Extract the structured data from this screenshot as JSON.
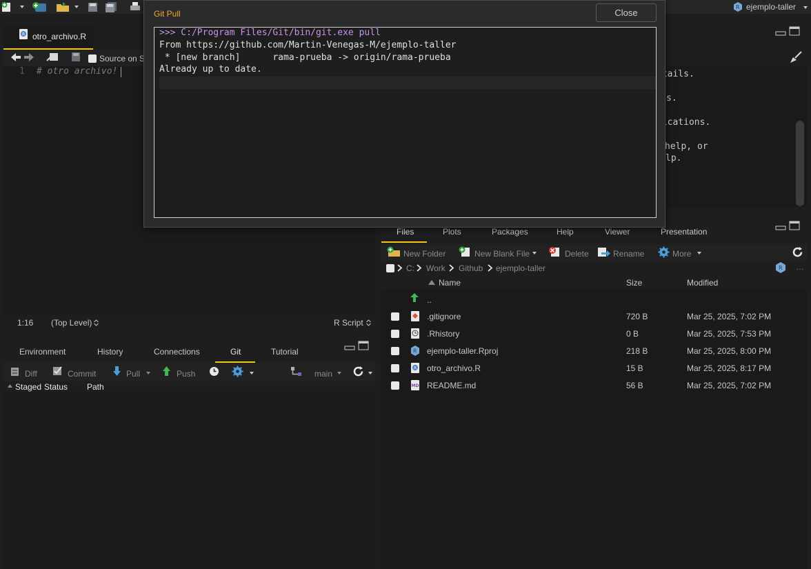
{
  "project": {
    "name": "ejemplo-taller"
  },
  "editor": {
    "tab_label": "otro_archivo.R",
    "source_on_save": "Source on S",
    "line_number": "1",
    "line_code": "# otro archivo!",
    "status_position": "1:16",
    "status_scope": "(Top Level)",
    "status_type": "R Script"
  },
  "bottom_left": {
    "tabs": [
      "Environment",
      "History",
      "Connections",
      "Git",
      "Tutorial"
    ],
    "active_tab": "Git",
    "toolbar": {
      "diff": "Diff",
      "commit": "Commit",
      "pull": "Pull",
      "push": "Push",
      "branch": "main"
    },
    "columns": {
      "staged": "Staged",
      "status": "Status",
      "path": "Path"
    }
  },
  "console": {
    "fragments": [
      "etails.",
      "s.",
      "lications.",
      " help, or",
      "lp."
    ]
  },
  "files": {
    "tabs": [
      "Files",
      "Plots",
      "Packages",
      "Help",
      "Viewer",
      "Presentation"
    ],
    "active_tab": "Files",
    "toolbar": {
      "new_folder": "New Folder",
      "new_blank_file": "New Blank File",
      "delete": "Delete",
      "rename": "Rename",
      "more": "More"
    },
    "breadcrumb": [
      "C:",
      "Work",
      "Github",
      "ejemplo-taller"
    ],
    "columns": {
      "name": "Name",
      "size": "Size",
      "modified": "Modified"
    },
    "parent": "..",
    "rows": [
      {
        "name": ".gitignore",
        "size": "720 B",
        "modified": "Mar 25, 2025, 7:02 PM",
        "icon": "git-file-icon"
      },
      {
        "name": ".Rhistory",
        "size": "0 B",
        "modified": "Mar 25, 2025, 7:53 PM",
        "icon": "history-file-icon"
      },
      {
        "name": "ejemplo-taller.Rproj",
        "size": "218 B",
        "modified": "Mar 25, 2025, 8:00 PM",
        "icon": "rproj-file-icon"
      },
      {
        "name": "otro_archivo.R",
        "size": "15 B",
        "modified": "Mar 25, 2025, 8:17 PM",
        "icon": "r-file-icon"
      },
      {
        "name": "README.md",
        "size": "56 B",
        "modified": "Mar 25, 2025, 7:02 PM",
        "icon": "markdown-file-icon"
      }
    ]
  },
  "dialog": {
    "title": "Git Pull",
    "close_label": "Close",
    "output": [
      ">>> C:/Program Files/Git/bin/git.exe pull",
      "From https://github.com/Martin-Venegas-M/ejemplo-taller",
      " * [new branch]      rama-prueba -> origin/rama-prueba",
      "Already up to date."
    ]
  },
  "colors": {
    "accent": "#f5c518",
    "dialog_title": "#f5a623",
    "command": "#c792ea"
  }
}
